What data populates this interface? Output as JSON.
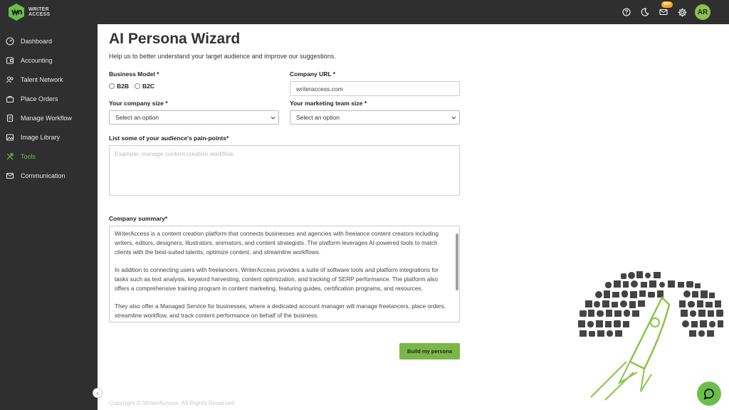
{
  "brand": {
    "line1": "WRITER",
    "line2": "ACCESS",
    "accent": "#6abf4b"
  },
  "header": {
    "icons": [
      "help-icon",
      "dark-mode-icon",
      "mail-icon",
      "settings-icon"
    ],
    "mail_badge": "99+",
    "avatar_initials": "AR"
  },
  "sidebar": {
    "items": [
      {
        "label": "Dashboard",
        "icon": "dashboard-icon"
      },
      {
        "label": "Accounting",
        "icon": "accounting-icon"
      },
      {
        "label": "Talent Network",
        "icon": "talent-network-icon"
      },
      {
        "label": "Place Orders",
        "icon": "place-orders-icon"
      },
      {
        "label": "Manage Workflow",
        "icon": "workflow-icon"
      },
      {
        "label": "Image Library",
        "icon": "image-library-icon"
      },
      {
        "label": "Tools",
        "icon": "tools-icon",
        "active": true
      },
      {
        "label": "Communication",
        "icon": "communication-icon"
      }
    ],
    "collapse": "‹"
  },
  "page": {
    "title": "AI Persona Wizard",
    "subtitle": "Help us to better understand your target audience and improve our suggestions."
  },
  "form": {
    "business_model_label": "Business Model *",
    "options": [
      "B2B",
      "B2C"
    ],
    "company_url_label": "Company URL *",
    "company_url_value": "writeraccess.com",
    "company_size_label": "Your company size *",
    "company_size_value": "Select an option",
    "team_size_label": "Your marketing team size *",
    "team_size_value": "Select an option",
    "pain_points_label": "List some of your audience's pain-points*",
    "pain_points_placeholder": "Example: manage content creation workflow",
    "summary_label": "Company summary*",
    "summary_paragraphs": [
      "WriterAccess is a content creation platform that connects businesses and agencies with freelance content creators including writers, editors, designers, illustrators, animators, and content strategists. The platform leverages AI-powered tools to match clients with the best-suited talents, optimize content, and streamline workflows.",
      "In addition to connecting users with freelancers, WriterAccess provides a suite of software tools and platform integrations for tasks such as text analysis, keyword harvesting, content optimization, and tracking of SERP performance. The platform also offers a comprehensive training program in content marketing, featuring guides, certification programs, and resources.",
      "They also offer a Managed Service for businesses, where a dedicated account manager will manage freelancers, place orders, streamline workflow, and track content performance on behalf of the business."
    ],
    "submit_label": "Build my persona"
  },
  "footer": {
    "copyright": "Copyright © WriterAccess. All Rights Reserved."
  }
}
